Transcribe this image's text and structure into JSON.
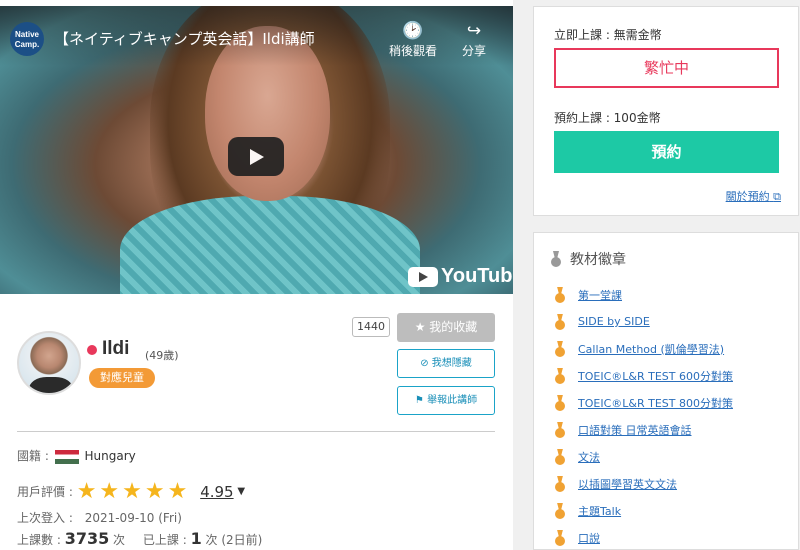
{
  "video": {
    "channel_logo": "Native Camp.",
    "title": "【ネイティブキャンプ英会話】Ildi講師",
    "watch_later": "稍後觀看",
    "share": "分享",
    "watermark": "YouTube"
  },
  "profile": {
    "name": "Ildi",
    "age": "(49歲)",
    "kids_badge": "對應兒童",
    "favorite_count": "1440",
    "favorite_label": "我的收藏",
    "hide_label": "我想隱藏",
    "report_label": "舉報此講師",
    "nationality_label": "國籍 :",
    "nationality": "Hungary",
    "rating_label": "用戶評價 :",
    "rating_stars": 5,
    "rating_value": "4.95",
    "last_login_label": "上次登入 :",
    "last_login": "2021-09-10 (Fri)",
    "lessons_label": "上課數 :",
    "lessons_count": "3735",
    "lessons_unit": "次",
    "attended_label": "已上課 :",
    "attended_count": "1",
    "attended_unit": "次 (2日前)"
  },
  "booking": {
    "instant_label": "立即上課 : 無需金幣",
    "busy": "繁忙中",
    "reserve_label": "預約上課 : 100金幣",
    "reserve_button": "預約",
    "about_link": "關於預約"
  },
  "badges": {
    "title": "教材徽章",
    "items": [
      "第一堂課",
      "SIDE by SIDE",
      "Callan Method (凱倫學習法)",
      "TOEIC®L&R TEST 600分對策",
      "TOEIC®L&R TEST 800分對策",
      "口語對策 日常英語會話",
      "文法",
      "以插圖學習英文文法",
      "主題Talk",
      "口說"
    ]
  },
  "colors": {
    "busy": "#e8385b",
    "reserve": "#1dc9a5",
    "kids_badge": "#f39a36",
    "link": "#2a6ebb",
    "star": "#f5b51d"
  }
}
